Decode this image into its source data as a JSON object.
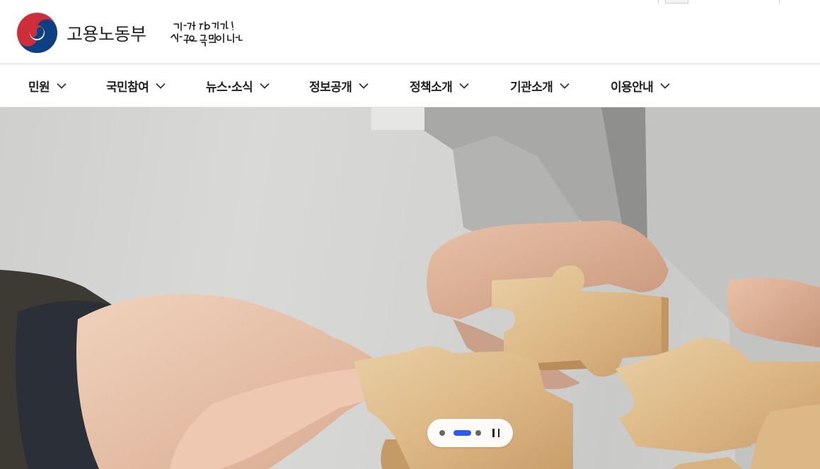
{
  "header": {
    "org_name": "고용노동부",
    "slogan": "다시 대한민국! 새로운 국민의 나라"
  },
  "nav": {
    "items": [
      {
        "label": "민원"
      },
      {
        "label": "국민참여"
      },
      {
        "label": "뉴스·소식"
      },
      {
        "label": "정보공개"
      },
      {
        "label": "정책소개"
      },
      {
        "label": "기관소개"
      },
      {
        "label": "이용안내"
      }
    ]
  },
  "hero": {
    "slide_count": 3,
    "active_slide": 2,
    "icons": {
      "nav": "chevron-down-icon",
      "pause": "pause-icon"
    },
    "colors": {
      "active_dot": "#2e5bf0",
      "inactive_dot": "#666666"
    }
  }
}
